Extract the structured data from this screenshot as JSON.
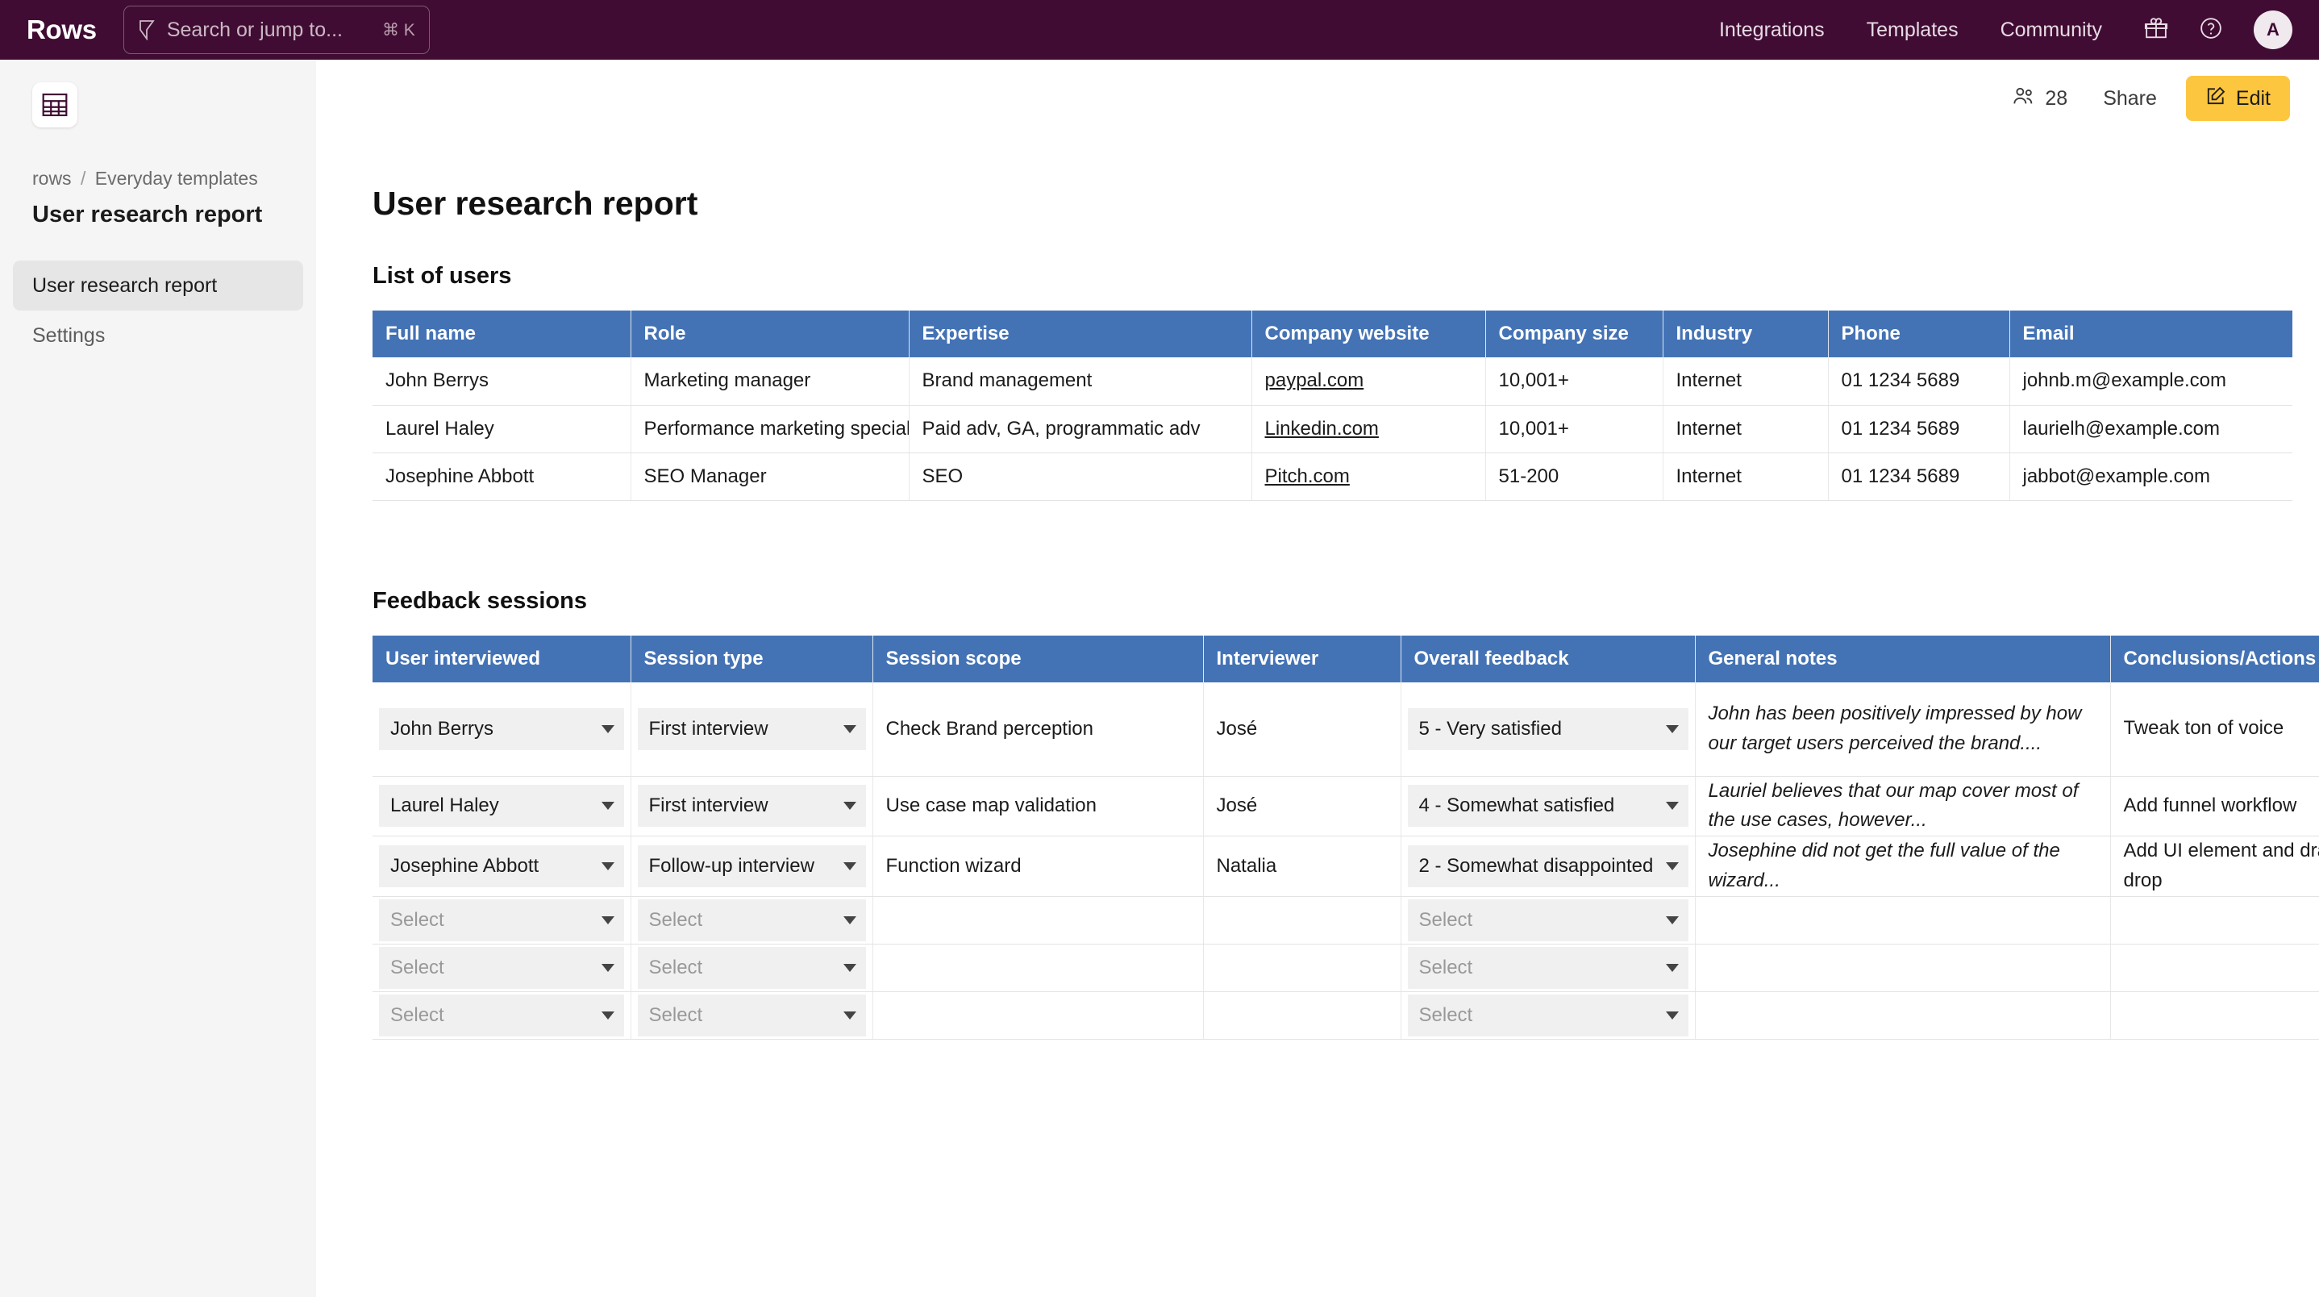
{
  "topbar": {
    "brand": "Rows",
    "search": {
      "placeholder": "Search or jump to...",
      "shortcut": "⌘ K",
      "icon": "search-icon"
    },
    "nav": [
      {
        "label": "Integrations"
      },
      {
        "label": "Templates"
      },
      {
        "label": "Community"
      }
    ],
    "icons": [
      {
        "name": "gift-icon"
      },
      {
        "name": "help-icon"
      }
    ],
    "avatar": "A",
    "background": "#400c33"
  },
  "sidebar": {
    "app_icon": "spreadsheet-icon",
    "breadcrumb": {
      "root": "rows",
      "separator": "/",
      "folder": "Everyday templates"
    },
    "doc_title": "User research report",
    "items": [
      {
        "label": "User research report",
        "active": true
      },
      {
        "label": "Settings",
        "active": false
      }
    ]
  },
  "toolbar": {
    "viewers_icon": "people-icon",
    "viewers_count": "28",
    "share_label": "Share",
    "edit_label": "Edit",
    "edit_icon": "pencil-square-icon",
    "edit_color": "#fdc63f"
  },
  "page": {
    "title": "User research report"
  },
  "users_table": {
    "section_title": "List of users",
    "header_color": "#4473b5",
    "columns": [
      "Full name",
      "Role",
      "Expertise",
      "Company website",
      "Company size",
      "Industry",
      "Phone",
      "Email"
    ],
    "rows": [
      {
        "full_name": "John Berrys",
        "role": "Marketing manager",
        "expertise": "Brand management",
        "company_website": "paypal.com",
        "company_size": "10,001+",
        "industry": "Internet",
        "phone": "01 1234 5689",
        "email": "johnb.m@example.com"
      },
      {
        "full_name": "Laurel Haley",
        "role": "Performance marketing specialist",
        "expertise": "Paid adv, GA, programmatic adv",
        "company_website": "Linkedin.com",
        "company_size": "10,001+",
        "industry": "Internet",
        "phone": "01 1234 5689",
        "email": "laurielh@example.com"
      },
      {
        "full_name": "Josephine Abbott",
        "role": "SEO Manager",
        "expertise": "SEO",
        "company_website": "Pitch.com",
        "company_size": "51-200",
        "industry": "Internet",
        "phone": "01 1234 5689",
        "email": "jabbot@example.com"
      }
    ]
  },
  "feedback_table": {
    "section_title": "Feedback sessions",
    "header_color": "#4473b5",
    "placeholder": "Select",
    "columns": [
      "User interviewed",
      "Session type",
      "Session scope",
      "Interviewer",
      "Overall feedback",
      "General notes",
      "Conclusions/Actions"
    ],
    "rows": [
      {
        "user_interviewed": "John Berrys",
        "session_type": "First interview",
        "session_scope": "Check Brand perception",
        "interviewer": "José",
        "overall_feedback": "5 - Very satisfied",
        "general_notes": "John has been positively impressed by how our target users perceived the brand....",
        "conclusions": "Tweak ton of voice"
      },
      {
        "user_interviewed": "Laurel Haley",
        "session_type": "First interview",
        "session_scope": "Use case map validation",
        "interviewer": "José",
        "overall_feedback": "4 - Somewhat satisfied",
        "general_notes": "Lauriel believes that our map cover most of the use cases, however...",
        "conclusions": "Add funnel workflow"
      },
      {
        "user_interviewed": "Josephine Abbott",
        "session_type": "Follow-up interview",
        "session_scope": "Function wizard",
        "interviewer": "Natalia",
        "overall_feedback": "2 - Somewhat disappointed",
        "general_notes": "Josephine did not get the full value of the wizard...",
        "conclusions": "Add UI element and drag-drop"
      },
      {
        "user_interviewed": "",
        "session_type": "",
        "session_scope": "",
        "interviewer": "",
        "overall_feedback": "",
        "general_notes": "",
        "conclusions": ""
      },
      {
        "user_interviewed": "",
        "session_type": "",
        "session_scope": "",
        "interviewer": "",
        "overall_feedback": "",
        "general_notes": "",
        "conclusions": ""
      },
      {
        "user_interviewed": "",
        "session_type": "",
        "session_scope": "",
        "interviewer": "",
        "overall_feedback": "",
        "general_notes": "",
        "conclusions": ""
      }
    ]
  }
}
